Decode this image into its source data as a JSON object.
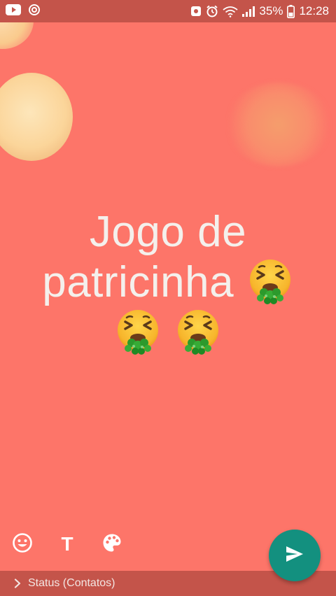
{
  "status_bar": {
    "battery": "35%",
    "time": "12:28",
    "icons": [
      "youtube-icon",
      "sync-icon",
      "notification-icon",
      "alarm-icon",
      "wifi-icon",
      "signal-icon",
      "battery-icon"
    ]
  },
  "status": {
    "line1": "Jogo de",
    "line2": "patricinha",
    "emoji_name": "nauseated-face-vomiting",
    "background_color": "#fd7569"
  },
  "tools": {
    "text_label": "T",
    "icons": [
      "emoji-icon",
      "text-icon",
      "palette-icon"
    ]
  },
  "send": {
    "icon": "send-icon",
    "color": "#13907f"
  },
  "recipients": {
    "label": "Status (Contatos)"
  }
}
